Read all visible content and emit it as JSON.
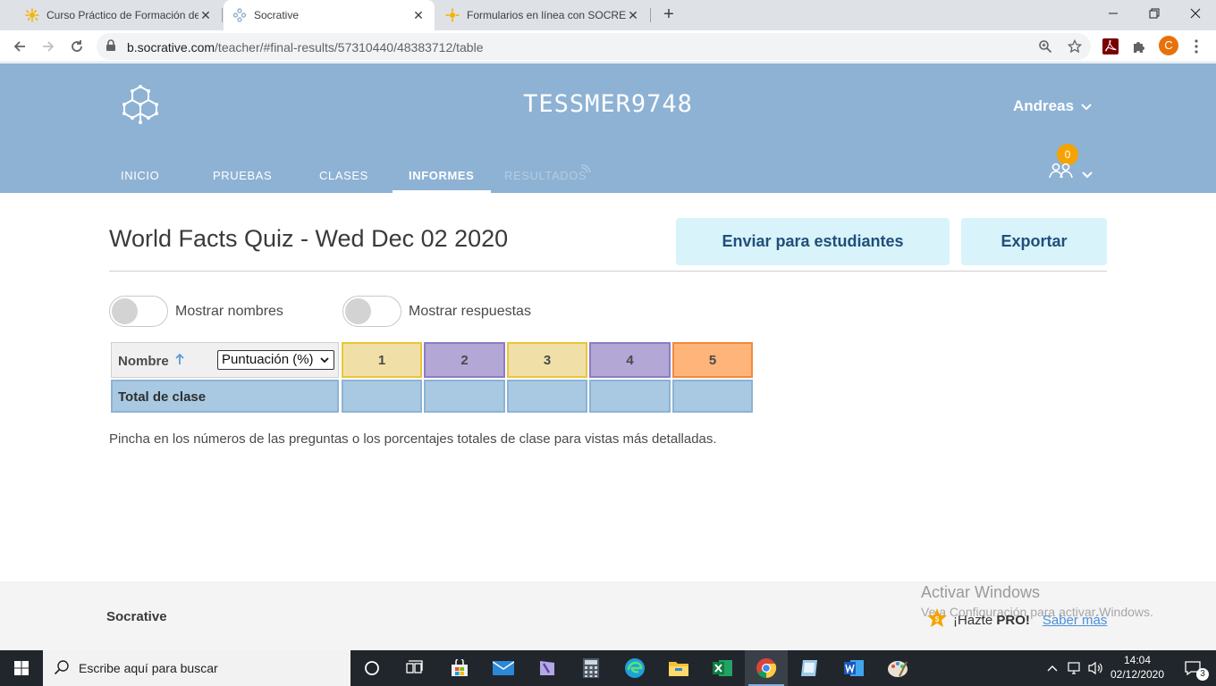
{
  "browser": {
    "tabs": [
      {
        "title": "Curso Práctico de Formación de ",
        "active": false
      },
      {
        "title": "Socrative",
        "active": true
      },
      {
        "title": "Formularios en línea con SOCREA",
        "active": false
      }
    ],
    "url_domain": "b.socrative.com",
    "url_path": "/teacher/#final-results/57310440/48383712/table",
    "profile_initial": "C"
  },
  "header": {
    "room_name": "TESSMER9748",
    "user_name": "Andreas",
    "notification_count": "0",
    "nav": {
      "inicio": "INICIO",
      "pruebas": "PRUEBAS",
      "clases": "CLASES",
      "informes": "INFORMES",
      "resultados": "RESULTADOS"
    }
  },
  "report": {
    "title": "World Facts Quiz - Wed Dec 02 2020",
    "send_button": "Enviar para estudiantes",
    "export_button": "Exportar",
    "toggle_names": "Mostrar nombres",
    "toggle_answers": "Mostrar respuestas",
    "name_header": "Nombre",
    "sort_select": "Puntuación (%)",
    "questions": [
      {
        "label": "1",
        "color": "#f0e0a8",
        "border": "#e9c63a"
      },
      {
        "label": "2",
        "color": "#b3a7d6",
        "border": "#8e7cc3"
      },
      {
        "label": "3",
        "color": "#f0e0a8",
        "border": "#e9c63a"
      },
      {
        "label": "4",
        "color": "#b3a7d6",
        "border": "#8e7cc3"
      },
      {
        "label": "5",
        "color": "#ffb47a",
        "border": "#f08a3c"
      }
    ],
    "total_label": "Total de clase",
    "hint": "Pincha en los números de las preguntas o los porcentajes totales de clase para vistas más detalladas."
  },
  "footer": {
    "brand": "Socrative",
    "pro_text": "¡Hazte",
    "pro_bold": "PRO!",
    "learn_more": "Saber más",
    "watermark_title": "Activar Windows",
    "watermark_sub": "Ve a Configuración para activar Windows."
  },
  "taskbar": {
    "search_placeholder": "Escribe aquí para buscar",
    "time": "14:04",
    "date": "02/12/2020",
    "notifications": "3"
  },
  "colors": {
    "header_bg": "#8db2d4",
    "total_row": "#a9c9e2",
    "button_bg": "#d9f3fb",
    "button_text": "#1f4f7a"
  }
}
